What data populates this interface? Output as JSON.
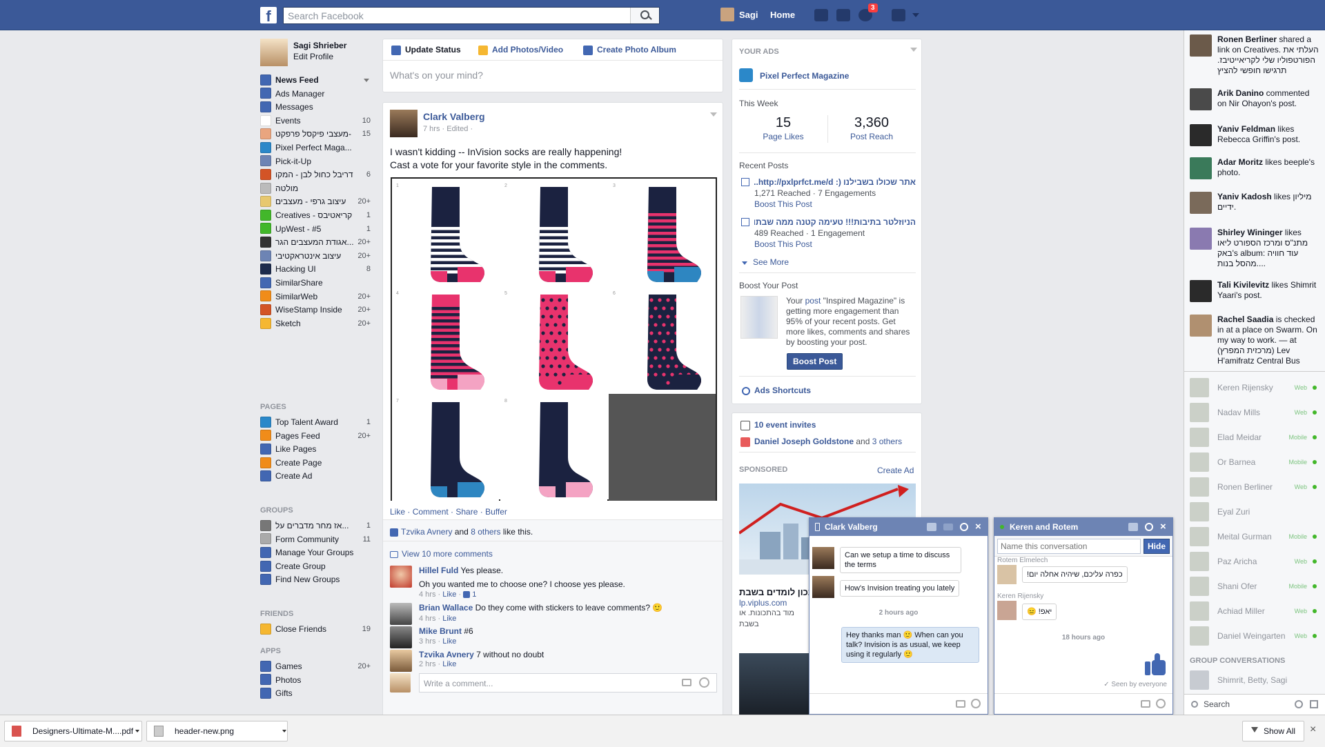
{
  "topbar": {
    "search_placeholder": "Search Facebook",
    "user_name": "Sagi",
    "home": "Home",
    "notification_count": "3"
  },
  "leftnav": {
    "profile_name": "Sagi Shrieber",
    "edit_profile": "Edit Profile",
    "favorites": [
      {
        "label": "News Feed",
        "count": "",
        "icon": "news-feed-icon",
        "color": "#4267b2"
      },
      {
        "label": "Ads Manager",
        "count": "",
        "icon": "ads-manager-icon",
        "color": "#4267b2"
      },
      {
        "label": "Messages",
        "count": "",
        "icon": "messages-icon",
        "color": "#4267b2"
      },
      {
        "label": "Events",
        "count": "10",
        "icon": "events-icon",
        "color": "#ffffff"
      },
      {
        "label": "מעצבי פיקסל פרפקט-",
        "count": "15",
        "icon": "group-icon",
        "color": "#e9a57f"
      },
      {
        "label": "Pixel Perfect Maga...",
        "count": "",
        "icon": "page-icon",
        "color": "#2b88c9"
      },
      {
        "label": "Pick-it-Up",
        "count": "",
        "icon": "flask-icon",
        "color": "#6d84b4"
      },
      {
        "label": "דריבל כחול לבן - המקו",
        "count": "6",
        "icon": "dribbble-icon",
        "color": "#d35426"
      },
      {
        "label": "מולטה",
        "count": "",
        "icon": "group-icon",
        "color": "#bbbbbb"
      },
      {
        "label": "עיצוב גרפי - מעצבים",
        "count": "20+",
        "icon": "palette-icon",
        "color": "#e7c86f"
      },
      {
        "label": "Creatives - קריאטיבס",
        "count": "1",
        "icon": "creatives-icon",
        "color": "#42b72a"
      },
      {
        "label": "UpWest - #5",
        "count": "1",
        "icon": "upwest-icon",
        "color": "#42b72a"
      },
      {
        "label": "אגודת המעצבים הגר...",
        "count": "20+",
        "icon": "graduate-icon",
        "color": "#333333"
      },
      {
        "label": "עיצוב אינטראקטיבי",
        "count": "20+",
        "icon": "wand-icon",
        "color": "#6d84b4"
      },
      {
        "label": "Hacking UI",
        "count": "8",
        "icon": "hacking-ui-icon",
        "color": "#1d2b4d"
      },
      {
        "label": "SimilarShare",
        "count": "",
        "icon": "chart-icon",
        "color": "#4267b2"
      },
      {
        "label": "SimilarWeb",
        "count": "20+",
        "icon": "similarweb-icon",
        "color": "#f08c1a"
      },
      {
        "label": "WiseStamp Inside",
        "count": "20+",
        "icon": "wisestamp-icon",
        "color": "#d35426"
      },
      {
        "label": "Sketch",
        "count": "20+",
        "icon": "sketch-icon",
        "color": "#f5b731"
      }
    ],
    "pages_header": "PAGES",
    "pages": [
      {
        "label": "Top Talent Award",
        "count": "1",
        "icon": "award-icon",
        "color": "#2b88c9"
      },
      {
        "label": "Pages Feed",
        "count": "20+",
        "icon": "flag-icon",
        "color": "#f08c1a"
      },
      {
        "label": "Like Pages",
        "count": "",
        "icon": "like-icon",
        "color": "#4267b2"
      },
      {
        "label": "Create Page",
        "count": "",
        "icon": "plus-icon",
        "color": "#f08c1a"
      },
      {
        "label": "Create Ad",
        "count": "",
        "icon": "create-ad-icon",
        "color": "#4267b2"
      }
    ],
    "groups_header": "GROUPS",
    "groups": [
      {
        "label": "אז מחר מדברים על...",
        "count": "1",
        "icon": "skull-icon",
        "color": "#777777"
      },
      {
        "label": "Form Community",
        "count": "11",
        "icon": "group-icon",
        "color": "#aaaaaa"
      },
      {
        "label": "Manage Your Groups",
        "count": "",
        "icon": "manage-groups-icon",
        "color": "#4267b2"
      },
      {
        "label": "Create Group",
        "count": "",
        "icon": "create-group-icon",
        "color": "#4267b2"
      },
      {
        "label": "Find New Groups",
        "count": "",
        "icon": "find-groups-icon",
        "color": "#4267b2"
      }
    ],
    "friends_header": "FRIENDS",
    "friends": [
      {
        "label": "Close Friends",
        "count": "19",
        "icon": "star-icon",
        "color": "#f5b731"
      }
    ],
    "apps_header": "APPS",
    "apps": [
      {
        "label": "Games",
        "count": "20+",
        "icon": "games-icon",
        "color": "#4267b2"
      },
      {
        "label": "Photos",
        "count": "",
        "icon": "photos-icon",
        "color": "#4267b2"
      },
      {
        "label": "Gifts",
        "count": "",
        "icon": "gifts-icon",
        "color": "#4267b2"
      }
    ]
  },
  "composer": {
    "tab_status": "Update Status",
    "tab_photos": "Add Photos/Video",
    "tab_album": "Create Photo Album",
    "placeholder": "What's on your mind?"
  },
  "post": {
    "author": "Clark Valberg",
    "meta": "7 hrs · Edited ·",
    "text_line1": "I wasn't kidding -- InVision socks are really happening!",
    "text_line2": "Cast a vote for your favorite style in the comments.",
    "socks": [
      {
        "n": "1",
        "top": "#1b2240",
        "toe": "#e8336d",
        "pattern": "stripes-white",
        "accent": "#ffffff"
      },
      {
        "n": "2",
        "top": "#1b2240",
        "toe": "#e8336d",
        "pattern": "stripes-white",
        "accent": "#ffffff"
      },
      {
        "n": "3",
        "top": "#1b2240",
        "toe": "#2e86c1",
        "pattern": "stripes-pink",
        "accent": "#e8336d"
      },
      {
        "n": "4",
        "top": "#e8336d",
        "toe": "#f4a3c3",
        "pattern": "stripes-navy",
        "accent": "#1b2240"
      },
      {
        "n": "5",
        "top": "#e8336d",
        "toe": "#e8336d",
        "pattern": "dots-navy",
        "accent": "#1b2240"
      },
      {
        "n": "6",
        "top": "#1b2240",
        "toe": "#1b2240",
        "pattern": "dots-pink",
        "accent": "#e8336d"
      },
      {
        "n": "7",
        "top": "#1b2240",
        "toe": "#2e86c1",
        "pattern": "plain",
        "accent": "#1b2240"
      },
      {
        "n": "8",
        "top": "#1b2240",
        "toe": "#f4a3c3",
        "pattern": "plain",
        "accent": "#1b2240"
      }
    ],
    "actions": [
      "Like",
      "Comment",
      "Share",
      "Buffer"
    ],
    "likes_name": "Tzvika Avnery",
    "likes_rest": " and ",
    "likes_others": "8 others",
    "likes_tail": " like this.",
    "view_more": "View 10 more comments",
    "comments": [
      {
        "name": "Hillel Fuld",
        "text": "Yes please.",
        "text2": "Oh you wanted me to choose one? I choose yes please.",
        "meta": "4 hrs · ",
        "like": "Like",
        "likes": "1"
      },
      {
        "name": "Brian Wallace",
        "text": "Do they come with stickers to leave comments? 🙂",
        "meta": "4 hrs · ",
        "like": "Like"
      },
      {
        "name": "Mike Brunt",
        "text": "#6",
        "meta": "3 hrs · ",
        "like": "Like"
      },
      {
        "name": "Tzvika Avnery",
        "text": "7 without no doubt",
        "meta": "2 hrs · ",
        "like": "Like"
      }
    ],
    "write_comment": "Write a comment..."
  },
  "ads": {
    "header": "YOUR ADS",
    "page_name": "Pixel Perfect Magazine",
    "this_week": "This Week",
    "page_likes_value": "15",
    "page_likes_label": "Page Likes",
    "post_reach_value": "3,360",
    "post_reach_label": "Post Reach",
    "recent_posts": "Recent Posts",
    "posts": [
      {
        "title": "אתר שכולו בשבילנו (: http://pxlprfct.me/d...",
        "stats": "1,271 Reached · 7 Engagements",
        "boost": "Boost This Post"
      },
      {
        "title": "הניוזלטר בתיבות!!! טעימה קטנה ממה שבתו...",
        "stats": "489 Reached · 1 Engagement",
        "boost": "Boost This Post"
      }
    ],
    "see_more": "See More",
    "boost_header": "Boost Your Post",
    "boost_text_a": "Your ",
    "boost_text_link": "post",
    "boost_text_b": " \"Inspired Magazine\" is getting more engagement than 95% of your recent posts. Get more likes, comments and shares by boosting your post.",
    "boost_button": "Boost Post",
    "shortcuts": "Ads Shortcuts"
  },
  "events": {
    "invites": "10 event invites",
    "birthday_name": "Daniel Joseph Goldstone",
    "birthday_and": " and ",
    "birthday_others": "3 others",
    "sponsored": "SPONSORED",
    "create_ad": "Create Ad",
    "ad_title": "נכון לומדים בשבת",
    "ad_url": "lp.viplus.com",
    "ad_text1": "מוד בהתכונות. או",
    "ad_text2": "בשבת"
  },
  "ticker": [
    {
      "name": "Ronen Berliner",
      "text": " shared a link on Creatives. העלתי את הפורטפוליו שלי לקריאייטיבז. תרגישו חופשי להציץ"
    },
    {
      "name": "Arik Danino",
      "text": " commented on Nir Ohayon's post."
    },
    {
      "name": "Yaniv Feldman",
      "text": " likes Rebecca Griffin's post."
    },
    {
      "name": "Adar Moritz",
      "text": " likes beeple's photo."
    },
    {
      "name": "Yaniv Kadosh",
      "text": " likes מיליון ידיים."
    },
    {
      "name": "Shirley Wininger",
      "text": " likes מתנ\"ס ומרכז הספורט ליאו באק's album: עוד חוויה מהסל בנות...."
    },
    {
      "name": "Tali Kivilevitz",
      "text": " likes Shimrit Yaari's post."
    },
    {
      "name": "Rachel Saadia",
      "text": " is checked in at a place on Swarm. On my way to work. — at (מרכזית המפרץ) Lev H'amifratz Central Bus"
    }
  ],
  "chat_list": [
    {
      "name": "Keren Rijensky",
      "status": "Web"
    },
    {
      "name": "Nadav Mills",
      "status": "Web"
    },
    {
      "name": "Elad Meidar",
      "status": "Mobile"
    },
    {
      "name": "Or Barnea",
      "status": "Mobile"
    },
    {
      "name": "Ronen Berliner",
      "status": "Web"
    },
    {
      "name": "Eyal Zuri",
      "status": ""
    },
    {
      "name": "Meital Gurman",
      "status": "Mobile"
    },
    {
      "name": "Paz Aricha",
      "status": "Web"
    },
    {
      "name": "Shani Ofer",
      "status": "Mobile"
    },
    {
      "name": "Achiad Miller",
      "status": "Web"
    },
    {
      "name": "Daniel Weingarten",
      "status": "Web"
    }
  ],
  "group_conversations": "GROUP CONVERSATIONS",
  "group_conv_item": "Shimrit, Betty, Sagi",
  "chat_search": "Search",
  "chat1": {
    "title": "Clark Valberg",
    "msg1": "Can we setup a time to discuss the terms",
    "msg2": "How's Invision treating you lately",
    "time": "2 hours ago",
    "reply": "Hey thanks man 🙂 When can you talk? Invision is as usual, we keep using it regularly 🙂"
  },
  "chat2": {
    "title": "Keren and Rotem",
    "name_placeholder": "Name this conversation",
    "hide": "Hide",
    "sender1": "Rotem Elmelech",
    "msg1": "כפרה עליכם, שיהיה אחלה יום!",
    "sender2": "Keren Rijensky",
    "msg2": "😑 !יאפ",
    "time": "18 hours ago",
    "seen": "Seen by everyone"
  },
  "downloads": {
    "file1": "Designers-Ultimate-M....pdf",
    "file2": "header-new.png",
    "show_all": "Show All"
  }
}
